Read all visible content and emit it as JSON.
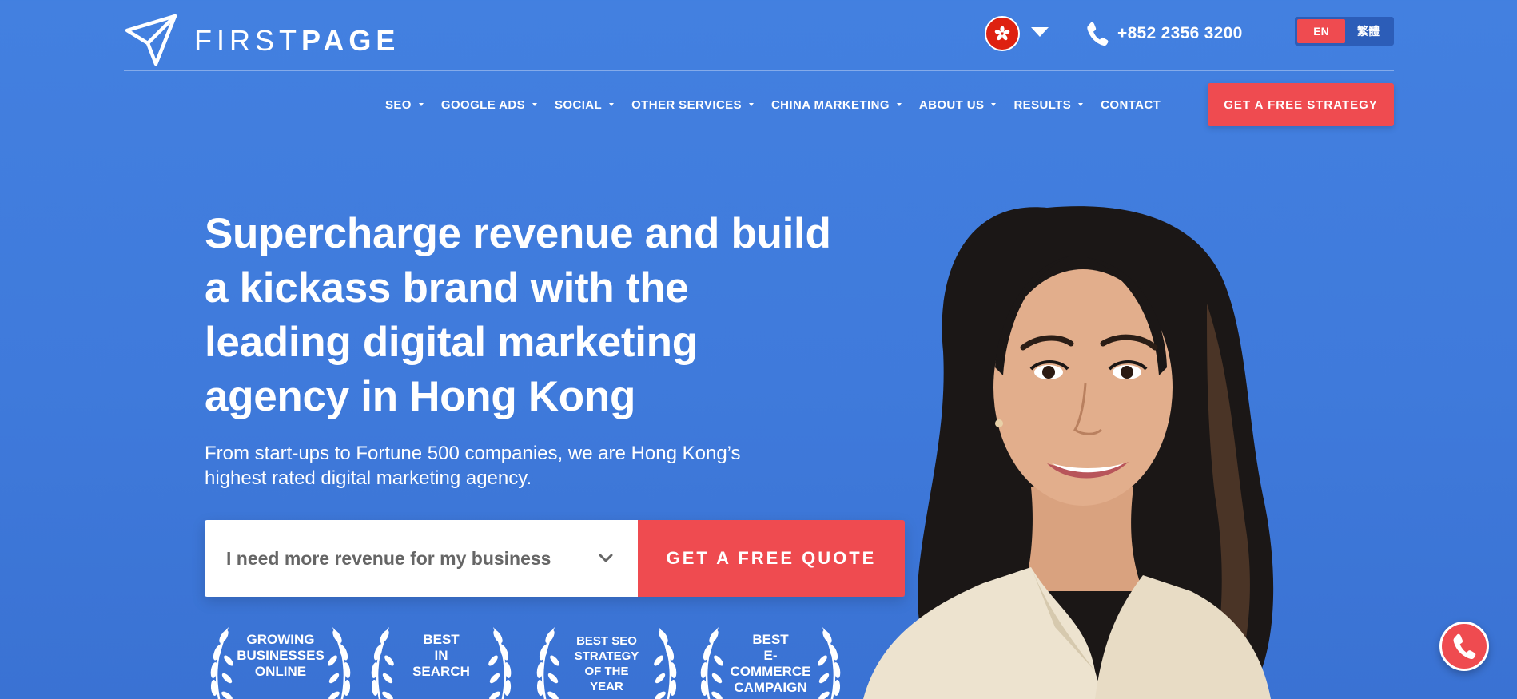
{
  "header": {
    "logo_light": "FIRST",
    "logo_bold": "PAGE",
    "phone": "+852 2356 3200",
    "lang_en": "EN",
    "lang_zh": "繁體",
    "flag_icon": "hong-kong-flag-icon"
  },
  "nav": {
    "items": [
      {
        "label": "SEO",
        "dropdown": true
      },
      {
        "label": "GOOGLE ADS",
        "dropdown": true
      },
      {
        "label": "SOCIAL",
        "dropdown": true
      },
      {
        "label": "OTHER SERVICES",
        "dropdown": true
      },
      {
        "label": "CHINA MARKETING",
        "dropdown": true
      },
      {
        "label": "ABOUT US",
        "dropdown": true
      },
      {
        "label": "RESULTS",
        "dropdown": true
      },
      {
        "label": "CONTACT",
        "dropdown": false
      }
    ],
    "cta": "GET A FREE STRATEGY"
  },
  "hero": {
    "headline_lines": [
      "Supercharge revenue and build",
      "a kickass brand with the",
      "leading digital marketing",
      "agency in Hong Kong"
    ],
    "subhead_lines": [
      "From start-ups to Fortune 500 companies, we are Hong Kong’s",
      "highest rated digital marketing agency."
    ],
    "select_value": "I need more revenue for my business",
    "quote_button": "GET A FREE QUOTE"
  },
  "awards": [
    {
      "lines": [
        "GROWING",
        "BUSINESSES",
        "ONLINE"
      ]
    },
    {
      "lines": [
        "BEST",
        "IN",
        "SEARCH"
      ]
    },
    {
      "lines": [
        "BEST SEO",
        "STRATEGY",
        "OF THE",
        "YEAR"
      ]
    },
    {
      "lines": [
        "BEST",
        "E-COMMERCE",
        "CAMPAIGN"
      ]
    }
  ],
  "colors": {
    "background": "#4380e0",
    "accent": "#ef4b50",
    "lang_toggle_bg": "#2c5db8"
  }
}
